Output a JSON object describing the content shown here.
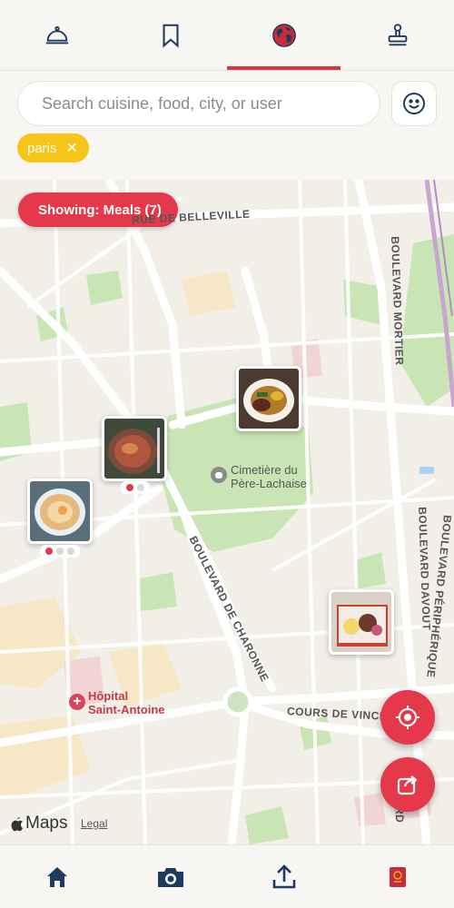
{
  "top_tabs": [
    {
      "name": "dining",
      "icon": "cloche-icon",
      "active": false
    },
    {
      "name": "saved",
      "icon": "bookmark-icon",
      "active": false
    },
    {
      "name": "map",
      "icon": "globe-icon",
      "active": true
    },
    {
      "name": "stamp",
      "icon": "stamp-icon",
      "active": false
    }
  ],
  "search": {
    "placeholder": "Search cuisine, food, city, or user"
  },
  "filter_chip": {
    "label": "paris",
    "close": "✕"
  },
  "map": {
    "showing_label": "Showing: Meals (7)",
    "street_labels": {
      "belleville": "RUE DE BELLEVILLE",
      "mortier": "BOULEVARD MORTIER",
      "davout": "BOULEVARD DAVOUT",
      "charonne": "BOULEVARD DE CHARONNE",
      "vincennes": "COURS DE VINCENNES",
      "peripherique": "BOULEVARD PÉRIPHÉRIQUE",
      "rd": "RD"
    },
    "poi": {
      "line1": "Cimetière du",
      "line2": "Père-Lachaise"
    },
    "hospital": {
      "line1": "Hôpital",
      "line2": "Saint-Antoine"
    },
    "brand": "Maps",
    "legal": "Legal"
  },
  "colors": {
    "accent": "#e5384a",
    "chip": "#f5c518",
    "icon_navy": "#1f3a5f"
  },
  "bottom_nav": [
    {
      "name": "home",
      "icon": "home-icon"
    },
    {
      "name": "camera",
      "icon": "camera-icon"
    },
    {
      "name": "upload",
      "icon": "upload-icon"
    },
    {
      "name": "passport",
      "icon": "passport-icon"
    }
  ]
}
